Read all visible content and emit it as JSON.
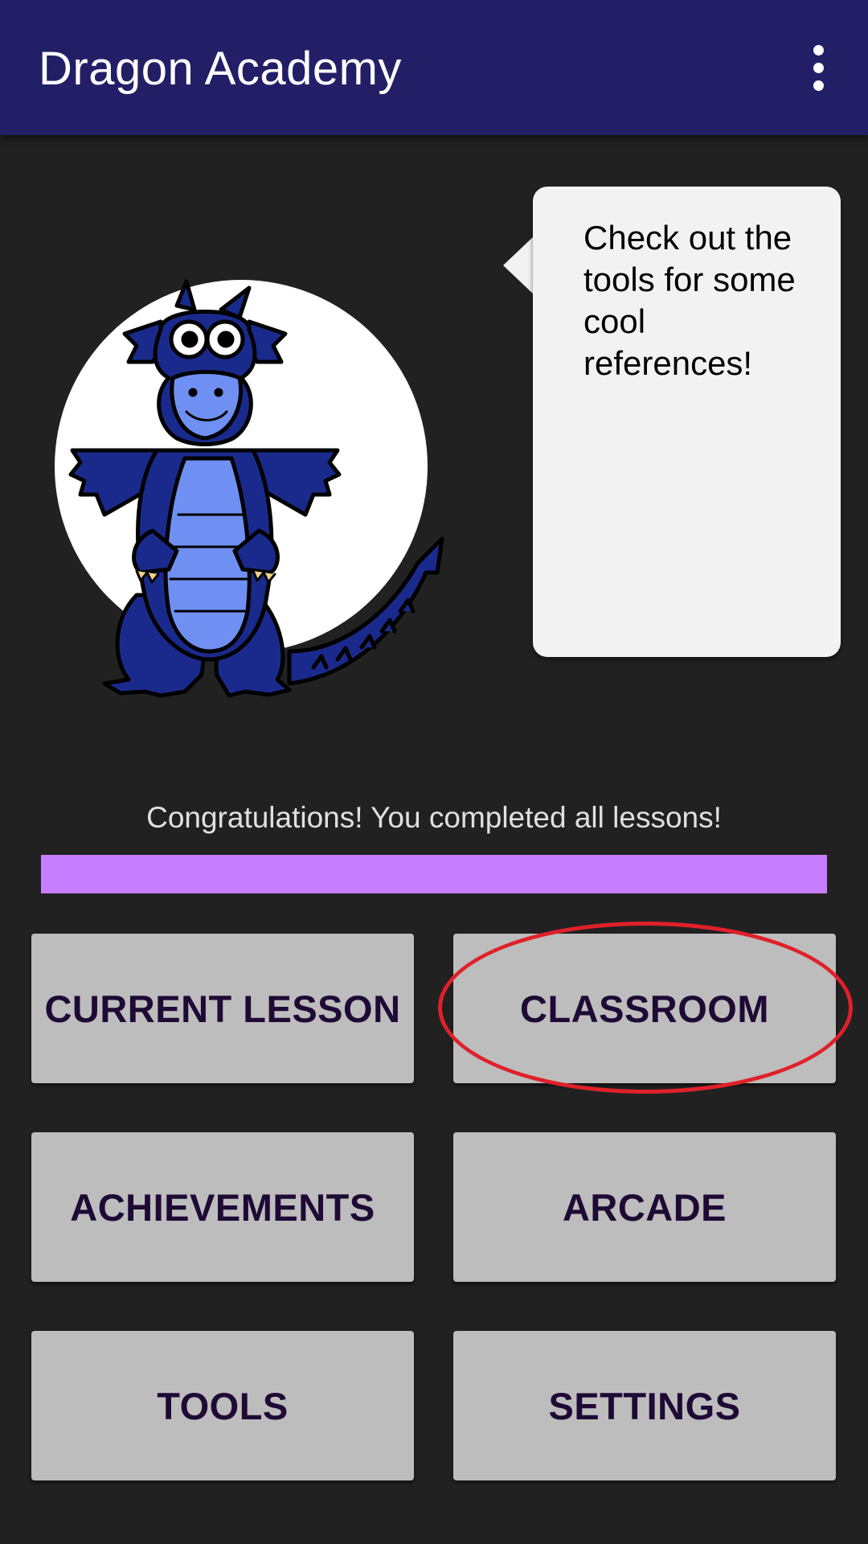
{
  "app_bar": {
    "title": "Dragon Academy",
    "menu_icon": "more-vert-icon"
  },
  "mascot": {
    "speech": "Check out the tools for some cool references!"
  },
  "progress": {
    "message": "Congratulations! You completed all lessons!",
    "value": 1.0,
    "color": "#c77dff"
  },
  "buttons": {
    "current_lesson": "CURRENT LESSON",
    "classroom": "CLASSROOM",
    "achievements": "ACHIEVEMENTS",
    "arcade": "ARCADE",
    "tools": "TOOLS",
    "settings": "SETTINGS"
  },
  "colors": {
    "app_bar": "#231f66",
    "background": "#212121",
    "button": "#bdbdbd",
    "button_text": "#1e0a35",
    "highlight": "#e0202a"
  }
}
